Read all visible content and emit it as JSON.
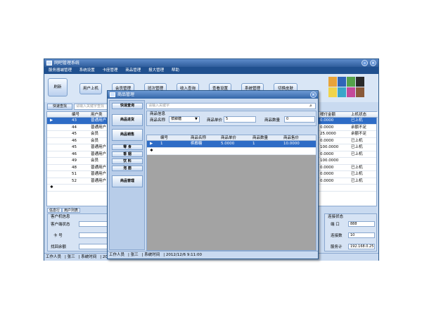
{
  "app": {
    "title": "网吧管理系统"
  },
  "menu": [
    "服务器端管理",
    "系统设置",
    "卡座管理",
    "商品管理",
    "报大管理",
    "帮助"
  ],
  "toolbar": {
    "refresh": "刷新",
    "user_online": "用户上机",
    "b3": "会员管理",
    "b4": "班次管理",
    "b5": "收入查询",
    "b6": "查看设置",
    "b7": "系统管理",
    "b8": "切换皮肤"
  },
  "search": {
    "button": "快速查找",
    "placeholder": "请输入关键字查找"
  },
  "grid": {
    "headers": [
      "编号",
      "用户类",
      "嗳付金额",
      "上机状态"
    ],
    "rows": [
      [
        "43",
        "普通用户",
        "0.0000",
        "已上机"
      ],
      [
        "44",
        "普通用户",
        "0.0000",
        "余额不足"
      ],
      [
        "45",
        "会员",
        "25.0000",
        "余额不足"
      ],
      [
        "46",
        "会员",
        "0.0000",
        "已上机"
      ],
      [
        "45",
        "普通用户",
        "100.0000",
        "已上机"
      ],
      [
        "46",
        "普通用户",
        "0.0000",
        "已上机"
      ],
      [
        "49",
        "会员",
        "100.0000",
        ""
      ],
      [
        "48",
        "普通用户",
        "0.0000",
        "已上机"
      ],
      [
        "51",
        "普通用户",
        "0.0000",
        "已上机"
      ],
      [
        "52",
        "普通用户",
        "0.0000",
        "已上机"
      ]
    ]
  },
  "bottom": {
    "tab1": "信息行",
    "tab2": "用户列表",
    "client_group": "客户机信息",
    "client_status": "客户端状态",
    "card_no": "卡    号",
    "balance": "找回余额",
    "conn_group": "连接状态",
    "port_label": "端    口",
    "port": "888",
    "conn_count_label": "连接数",
    "conn_count": "10",
    "server_label": "服务计",
    "server_ip": "192.168.0.25"
  },
  "status": {
    "staff_label": "工作人员",
    "staff": "张三",
    "time_label": "系统时间",
    "time": "20"
  },
  "dialog": {
    "title": "商品管理",
    "side": {
      "quick": "快速查询",
      "restock": "商品进货",
      "sales": "商品销售",
      "c1": "零    食",
      "c2": "香    烟",
      "c3": "饮    料",
      "c4": "泡    面",
      "manage": "商品管理"
    },
    "search_placeholder": "请输入关键字",
    "info_group": "商品信息",
    "name_label": "商品名称",
    "name_value": "槟榔糖",
    "price_label": "商品单价",
    "price_value": "5",
    "qty_label": "商品数量",
    "qty_value": "0",
    "headers": [
      "编号",
      "商品名称",
      "商品单价",
      "商品数量",
      "商品售价"
    ],
    "row": [
      "1",
      "槟榔糖",
      "5.0000",
      "1",
      "10.0000"
    ],
    "status": {
      "staff_label": "工作人员",
      "staff": "张三",
      "time_label": "系统时间",
      "time": "2012/12/6  9:11:00"
    }
  },
  "colors": {
    "titlebar": "#2f5d9c",
    "menubar": "#20508f",
    "selection": "#2e6cc6",
    "swatches": [
      "#e8a33a",
      "#2f65b8",
      "#55a24a",
      "#2a2a2a",
      "#f0d44a",
      "#3aa5c9",
      "#c44a9a",
      "#8a5a3a"
    ]
  }
}
